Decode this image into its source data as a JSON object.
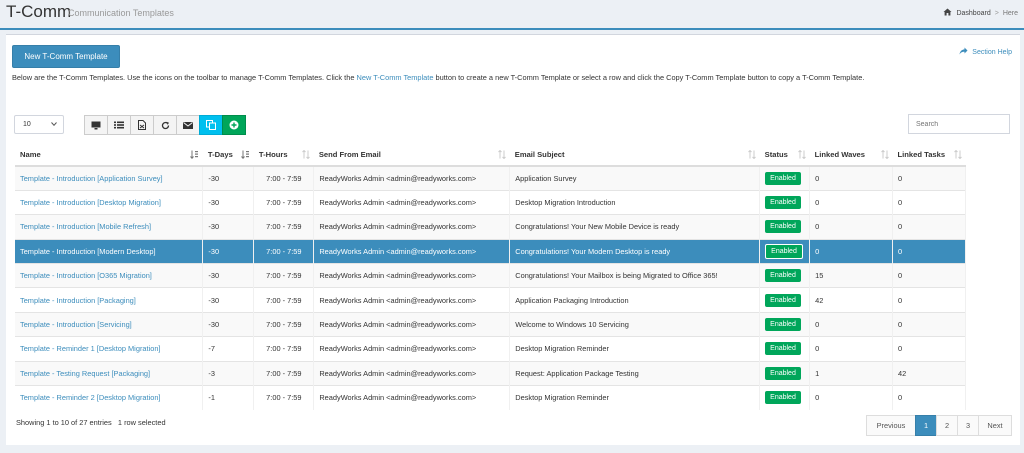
{
  "app": {
    "title": "T-Comm",
    "subtitle": "Communication Templates"
  },
  "breadcrumb": {
    "dashboard": "Dashboard",
    "separator": ">",
    "here": "Here"
  },
  "actions": {
    "new_template": "New T-Comm Template",
    "section_help": "Section Help"
  },
  "intro": {
    "before": "Below are the T-Comm Templates. Use the icons on the toolbar to manage T-Comm Templates. Click the ",
    "link": "New T-Comm Template",
    "after": " button to create a new T-Comm Template or select a row and click the Copy T-Comm Template button to copy a T-Comm Template."
  },
  "toolbar": {
    "page_length": "10",
    "search_placeholder": "Search",
    "icons": [
      "monitor-icon",
      "list-icon",
      "export-icon",
      "refresh-icon",
      "envelope-icon",
      "copy-icon",
      "add-icon"
    ]
  },
  "table": {
    "headers": [
      "Name",
      "T-Days",
      "T-Hours",
      "Send From Email",
      "Email Subject",
      "Status",
      "Linked Waves",
      "Linked Tasks"
    ],
    "rows": [
      {
        "name": "Template - Introduction [Application Survey]",
        "tdays": "-30",
        "thours": "7:00 - 7:59",
        "from": "ReadyWorks Admin <admin@readyworks.com>",
        "subject": "Application Survey",
        "status": "Enabled",
        "waves": "0",
        "tasks": "0"
      },
      {
        "name": "Template - Introduction [Desktop Migration]",
        "tdays": "-30",
        "thours": "7:00 - 7:59",
        "from": "ReadyWorks Admin <admin@readyworks.com>",
        "subject": "Desktop Migration Introduction",
        "status": "Enabled",
        "waves": "0",
        "tasks": "0"
      },
      {
        "name": "Template - Introduction [Mobile Refresh]",
        "tdays": "-30",
        "thours": "7:00 - 7:59",
        "from": "ReadyWorks Admin <admin@readyworks.com>",
        "subject": "Congratulations! Your New Mobile Device is ready",
        "status": "Enabled",
        "waves": "0",
        "tasks": "0"
      },
      {
        "name": "Template - Introduction [Modern Desktop]",
        "tdays": "-30",
        "thours": "7:00 - 7:59",
        "from": "ReadyWorks Admin <admin@readyworks.com>",
        "subject": "Congratulations! Your Modern Desktop is ready",
        "status": "Enabled",
        "waves": "0",
        "tasks": "0",
        "selected": true
      },
      {
        "name": "Template - Introduction [O365 Migration]",
        "tdays": "-30",
        "thours": "7:00 - 7:59",
        "from": "ReadyWorks Admin <admin@readyworks.com>",
        "subject": "Congratulations! Your Mailbox is being Migrated to Office 365!",
        "status": "Enabled",
        "waves": "15",
        "tasks": "0"
      },
      {
        "name": "Template - Introduction [Packaging]",
        "tdays": "-30",
        "thours": "7:00 - 7:59",
        "from": "ReadyWorks Admin <admin@readyworks.com>",
        "subject": "Application Packaging Introduction",
        "status": "Enabled",
        "waves": "42",
        "tasks": "0"
      },
      {
        "name": "Template - Introduction [Servicing]",
        "tdays": "-30",
        "thours": "7:00 - 7:59",
        "from": "ReadyWorks Admin <admin@readyworks.com>",
        "subject": "Welcome to Windows 10 Servicing",
        "status": "Enabled",
        "waves": "0",
        "tasks": "0"
      },
      {
        "name": "Template - Reminder 1 [Desktop Migration]",
        "tdays": "-7",
        "thours": "7:00 - 7:59",
        "from": "ReadyWorks Admin <admin@readyworks.com>",
        "subject": "Desktop Migration Reminder",
        "status": "Enabled",
        "waves": "0",
        "tasks": "0"
      },
      {
        "name": "Template - Testing Request [Packaging]",
        "tdays": "-3",
        "thours": "7:00 - 7:59",
        "from": "ReadyWorks Admin <admin@readyworks.com>",
        "subject": "Request: Application Package Testing",
        "status": "Enabled",
        "waves": "1",
        "tasks": "42"
      },
      {
        "name": "Template - Reminder 2 [Desktop Migration]",
        "tdays": "-1",
        "thours": "7:00 - 7:59",
        "from": "ReadyWorks Admin <admin@readyworks.com>",
        "subject": "Desktop Migration Reminder",
        "status": "Enabled",
        "waves": "0",
        "tasks": "0"
      }
    ]
  },
  "footer": {
    "showing": "Showing 1 to 10 of 27 entries",
    "selected": "1 row selected"
  },
  "pagination": {
    "previous": "Previous",
    "pages": [
      "1",
      "2",
      "3"
    ],
    "next": "Next",
    "current": "1"
  },
  "colors": {
    "primary": "#3c8dbc",
    "success": "#00a65a",
    "info": "#00c0ef"
  }
}
